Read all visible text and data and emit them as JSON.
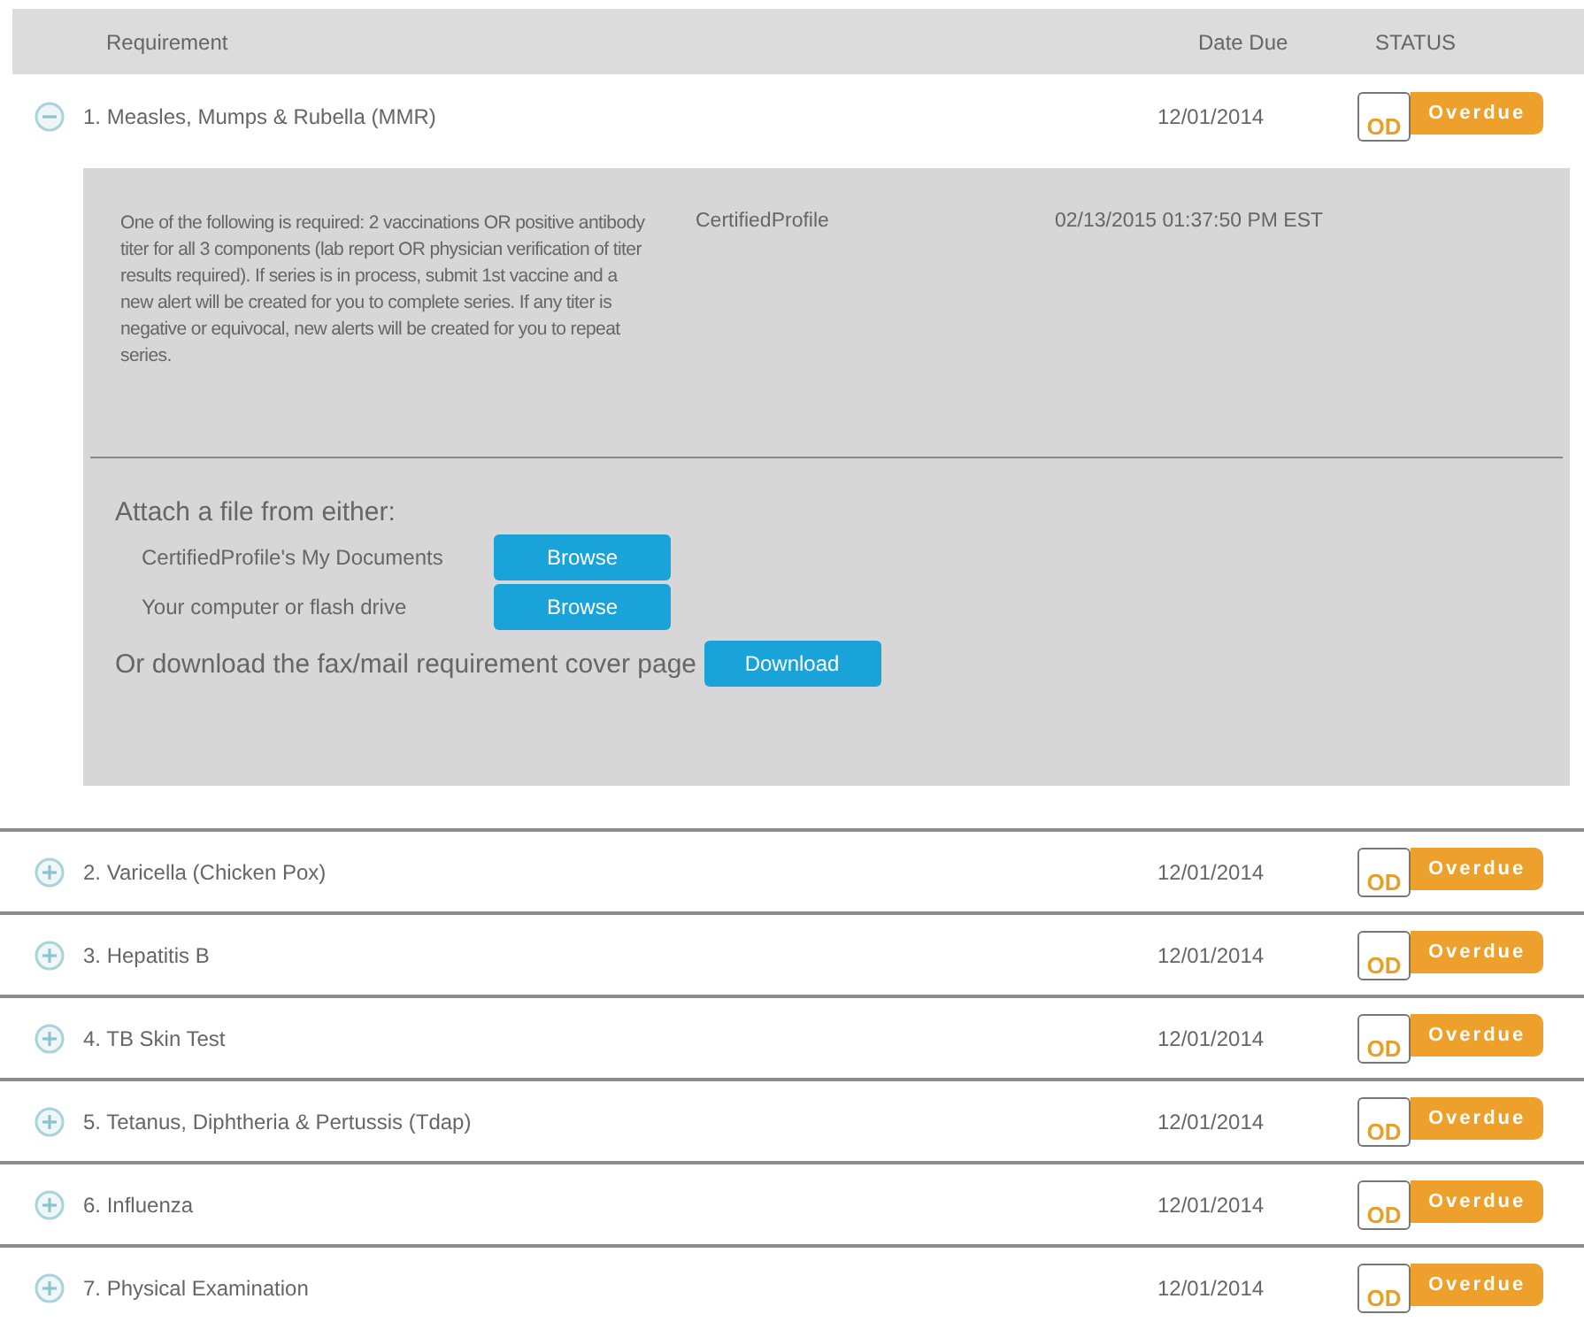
{
  "columns": [
    "Requirement",
    "Date Due",
    "STATUS"
  ],
  "rows": [
    {
      "name": "1. Measles, Mumps & Rubella (MMR)",
      "date_due": "12/01/2014",
      "status_code": "OD",
      "status": "Overdue",
      "expanded": true,
      "detail": {
        "description": "One of the following is required: 2 vaccinations OR positive antibody titer for all 3 components (lab report OR physician verification of titer results required). If series is in process, submit 1st vaccine and a new alert will be created for you to complete series. If any titer is negative or equivocal, new alerts will be created for you to repeat series.",
        "source": "CertifiedProfile",
        "timestamp": "02/13/2015 01:37:50 PM EST",
        "attach_heading": "Attach a file from either:",
        "attach_options": [
          {
            "label": "CertifiedProfile's My Documents",
            "button": "Browse"
          },
          {
            "label": "Your computer or flash drive",
            "button": "Browse"
          }
        ],
        "download_text": "Or download the fax/mail requirement cover page",
        "download_button": "Download"
      }
    },
    {
      "name": "2. Varicella (Chicken Pox)",
      "date_due": "12/01/2014",
      "status_code": "OD",
      "status": "Overdue",
      "expanded": false
    },
    {
      "name": "3. Hepatitis B",
      "date_due": "12/01/2014",
      "status_code": "OD",
      "status": "Overdue",
      "expanded": false
    },
    {
      "name": "4. TB Skin Test",
      "date_due": "12/01/2014",
      "status_code": "OD",
      "status": "Overdue",
      "expanded": false
    },
    {
      "name": "5. Tetanus, Diphtheria & Pertussis (Tdap)",
      "date_due": "12/01/2014",
      "status_code": "OD",
      "status": "Overdue",
      "expanded": false
    },
    {
      "name": "6. Influenza",
      "date_due": "12/01/2014",
      "status_code": "OD",
      "status": "Overdue",
      "expanded": false
    },
    {
      "name": "7. Physical Examination",
      "date_due": "12/01/2014",
      "status_code": "OD",
      "status": "Overdue",
      "expanded": false
    }
  ]
}
